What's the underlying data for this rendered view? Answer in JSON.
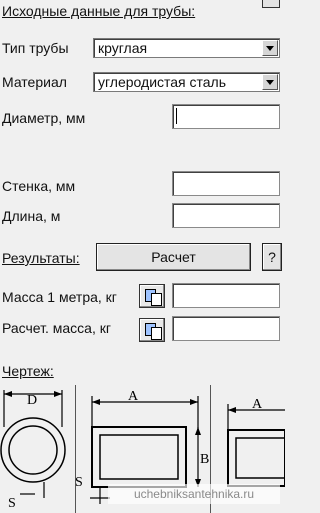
{
  "section_input": "Исходные данные для трубы:",
  "pipe_type": {
    "label": "Тип трубы",
    "value": "круглая"
  },
  "material": {
    "label": "Материал",
    "value": "углеродистая сталь"
  },
  "diameter": {
    "label": "Диаметр, мм",
    "value": ""
  },
  "wall": {
    "label": "Стенка, мм",
    "value": ""
  },
  "length": {
    "label": "Длина, м",
    "value": ""
  },
  "results": {
    "label": "Результаты:",
    "calc_button": "Расчет",
    "help_button": "?"
  },
  "mass_per_meter": {
    "label": "Масса 1 метра, кг",
    "value": ""
  },
  "calc_mass": {
    "label": "Расчет. масса, кг",
    "value": ""
  },
  "drawing": {
    "label": "Чертеж:",
    "dim_d": "D",
    "dim_a": "A",
    "dim_b": "B",
    "dim_s": "S"
  },
  "watermark": "uchebniksantehnika.ru"
}
